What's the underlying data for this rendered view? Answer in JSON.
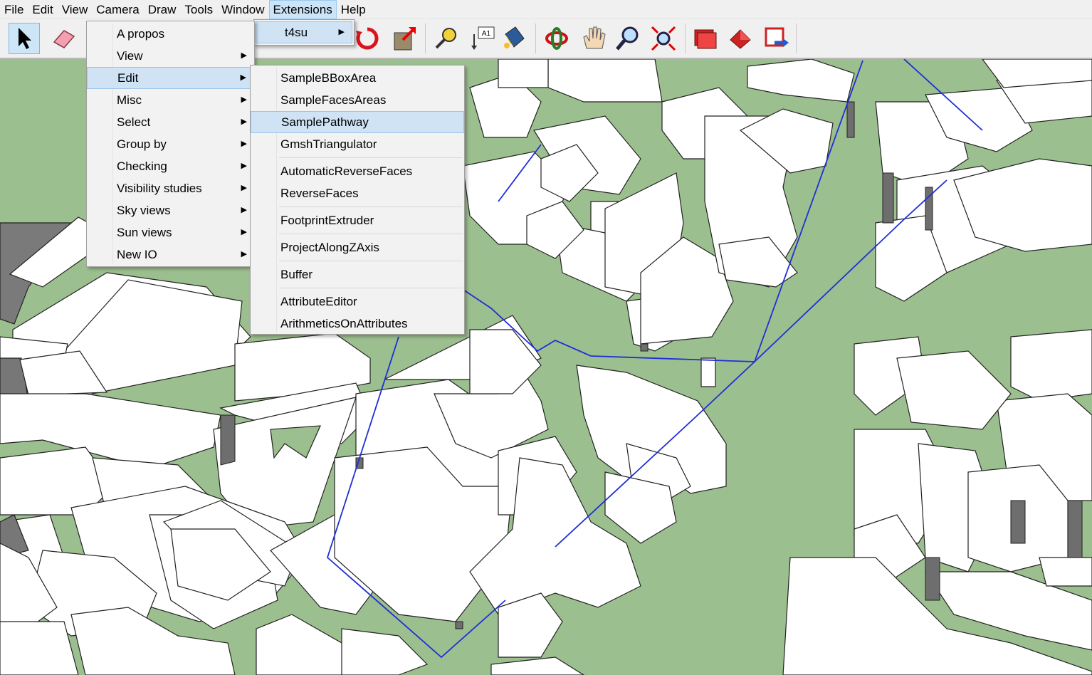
{
  "menubar": {
    "items": [
      "File",
      "Edit",
      "View",
      "Camera",
      "Draw",
      "Tools",
      "Window",
      "Extensions",
      "Help"
    ],
    "active": "Extensions"
  },
  "toolbar": {
    "icons": [
      "select-arrow-icon",
      "eraser-icon",
      "rotate-icon",
      "push-pull-icon",
      "tape-measure-icon",
      "text-icon",
      "paint-bucket-icon",
      "orbit-icon",
      "pan-hand-icon",
      "zoom-icon",
      "zoom-extents-icon",
      "ruby-console-icon",
      "extension-warehouse-icon",
      "extension-manager-icon"
    ]
  },
  "extensions_menu": {
    "items": [
      {
        "label": "t4su",
        "has_submenu": true
      }
    ]
  },
  "t4su_menu": {
    "items": [
      {
        "label": "A propos",
        "has_submenu": false
      },
      {
        "label": "View",
        "has_submenu": true
      },
      {
        "label": "Edit",
        "has_submenu": true
      },
      {
        "label": "Misc",
        "has_submenu": true
      },
      {
        "label": "Select",
        "has_submenu": true
      },
      {
        "label": "Group by",
        "has_submenu": true
      },
      {
        "label": "Checking",
        "has_submenu": true
      },
      {
        "label": "Visibility studies",
        "has_submenu": true
      },
      {
        "label": "Sky views",
        "has_submenu": true
      },
      {
        "label": "Sun views",
        "has_submenu": true
      },
      {
        "label": "New IO",
        "has_submenu": true
      }
    ],
    "highlighted": "Edit"
  },
  "edit_menu": {
    "groups": [
      [
        "SampleBBoxArea",
        "SampleFacesAreas",
        "SamplePathway",
        "GmshTriangulator"
      ],
      [
        "AutomaticReverseFaces",
        "ReverseFaces"
      ],
      [
        "FootprintExtruder"
      ],
      [
        "ProjectAlongZAxis"
      ],
      [
        "Buffer"
      ],
      [
        "AttributeEditor",
        "ArithmeticsOnAttributes"
      ]
    ],
    "highlighted": "SamplePathway"
  },
  "colors": {
    "ground": "#9cbf8f",
    "building_top": "#ffffff",
    "building_side": "#737373",
    "pathway_line": "#1f2fd6",
    "menu_highlight": "#cfe3f5"
  }
}
